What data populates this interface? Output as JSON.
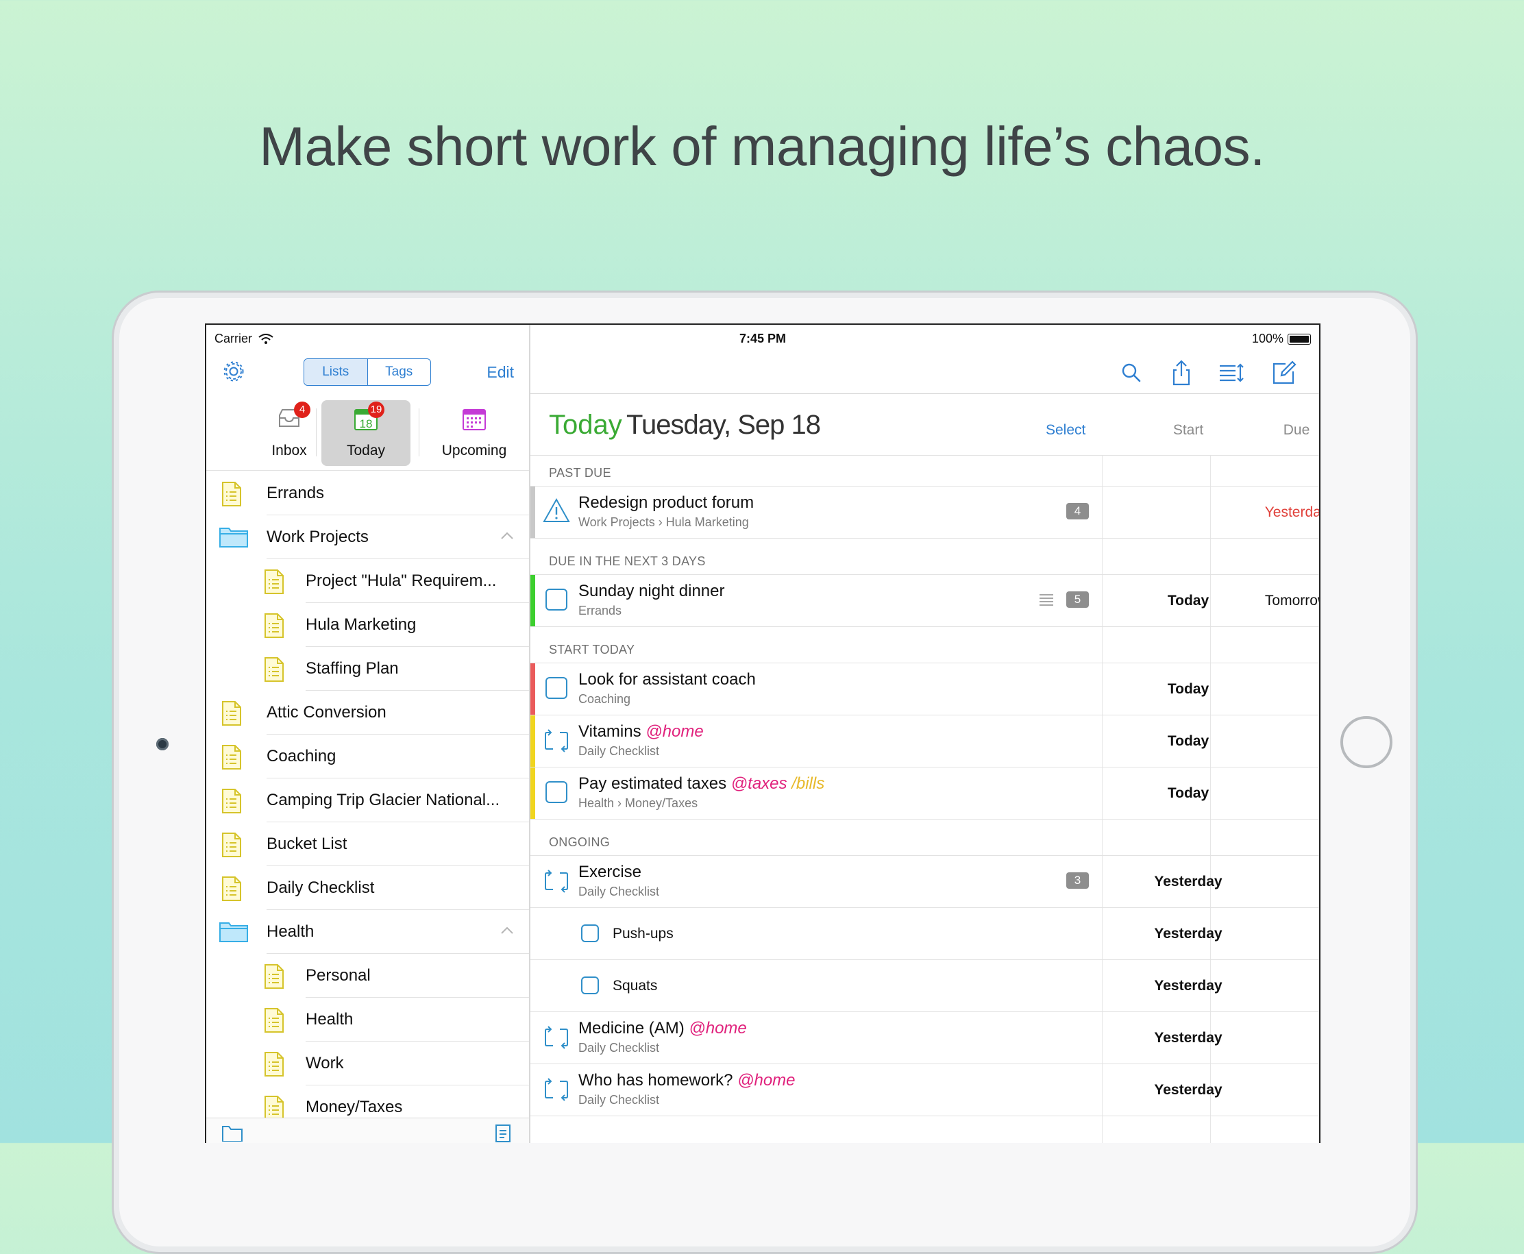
{
  "headline": "Make short work of managing life’s chaos.",
  "status_bar": {
    "carrier": "Carrier",
    "time": "7:45 PM",
    "battery": "100%"
  },
  "sidebar": {
    "segment": {
      "lists": "Lists",
      "tags": "Tags"
    },
    "edit_label": "Edit",
    "quick": [
      {
        "label": "Inbox",
        "badge": "4"
      },
      {
        "label": "Today",
        "badge": "19",
        "calendar_day": "18"
      },
      {
        "label": "Upcoming"
      }
    ],
    "lists": [
      {
        "label": "Errands",
        "type": "list"
      },
      {
        "label": "Work Projects",
        "type": "folder",
        "expanded": true
      },
      {
        "label": "Project \"Hula\" Requirem...",
        "type": "list",
        "indent": true
      },
      {
        "label": "Hula Marketing",
        "type": "list",
        "indent": true
      },
      {
        "label": "Staffing Plan",
        "type": "list",
        "indent": true
      },
      {
        "label": "Attic Conversion",
        "type": "list"
      },
      {
        "label": "Coaching",
        "type": "list"
      },
      {
        "label": "Camping Trip Glacier National...",
        "type": "list"
      },
      {
        "label": "Bucket List",
        "type": "list"
      },
      {
        "label": "Daily Checklist",
        "type": "list"
      },
      {
        "label": "Health",
        "type": "folder",
        "expanded": true
      },
      {
        "label": "Personal",
        "type": "list",
        "indent": true
      },
      {
        "label": "Health",
        "type": "list",
        "indent": true
      },
      {
        "label": "Work",
        "type": "list",
        "indent": true
      },
      {
        "label": "Money/Taxes",
        "type": "list",
        "indent": true
      }
    ]
  },
  "main": {
    "header": {
      "today": "Today",
      "date": "Tuesday, Sep 18",
      "select": "Select",
      "start_col": "Start",
      "due_col": "Due"
    },
    "sections": [
      {
        "title": "PAST DUE",
        "rows": [
          {
            "title": "Redesign product forum",
            "path": "Work Projects › Hula Marketing",
            "count": "4",
            "start": "",
            "due": "Yesterday",
            "due_red": true,
            "icon": "warning-icon",
            "bar": "#c8c8c8"
          }
        ]
      },
      {
        "title": "DUE IN THE NEXT 3 DAYS",
        "rows": [
          {
            "title": "Sunday night dinner",
            "path": "Errands",
            "count": "5",
            "note": true,
            "start": "Today",
            "due": "Tomorrow",
            "icon": "checkbox",
            "bar": "#3ccf2e"
          }
        ]
      },
      {
        "title": "START TODAY",
        "rows": [
          {
            "title": "Look for assistant coach",
            "path": "Coaching",
            "start": "Today",
            "due": "",
            "icon": "checkbox",
            "bar": "#ea5b5b"
          },
          {
            "title": "Vitamins",
            "tags": [
              {
                "t": "@home",
                "k": "at"
              }
            ],
            "path": "Daily Checklist",
            "start": "Today",
            "due": "",
            "icon": "repeat-icon",
            "bar": "#f0d51f"
          },
          {
            "title": "Pay estimated taxes",
            "tags": [
              {
                "t": "@taxes",
                "k": "at"
              },
              {
                "t": "/bills",
                "k": "sl"
              }
            ],
            "path": "Health › Money/Taxes",
            "start": "Today",
            "due": "",
            "icon": "checkbox",
            "bar": "#f0d51f"
          }
        ]
      },
      {
        "title": "ONGOING",
        "rows": [
          {
            "title": "Exercise",
            "path": "Daily Checklist",
            "count": "3",
            "start": "Yesterday",
            "due": "",
            "icon": "repeat-icon"
          },
          {
            "title": "Push-ups",
            "sub": true,
            "start": "Yesterday",
            "due": "",
            "icon": "checkbox"
          },
          {
            "title": "Squats",
            "sub": true,
            "start": "Yesterday",
            "due": "",
            "icon": "checkbox"
          },
          {
            "title": "Medicine (AM)",
            "tags": [
              {
                "t": "@home",
                "k": "at"
              }
            ],
            "path": "Daily Checklist",
            "start": "Yesterday",
            "due": "",
            "icon": "repeat-icon"
          },
          {
            "title": "Who has homework?",
            "tags": [
              {
                "t": "@home",
                "k": "at"
              }
            ],
            "path": "Daily Checklist",
            "start": "Yesterday",
            "due": "",
            "icon": "repeat-icon"
          }
        ]
      }
    ]
  },
  "colors": {
    "accent": "#2f7fd1",
    "today_green": "#3aaa34",
    "overdue_red": "#e0403a",
    "context_tag": "#e0217c",
    "folder_tag": "#e7b92a"
  }
}
